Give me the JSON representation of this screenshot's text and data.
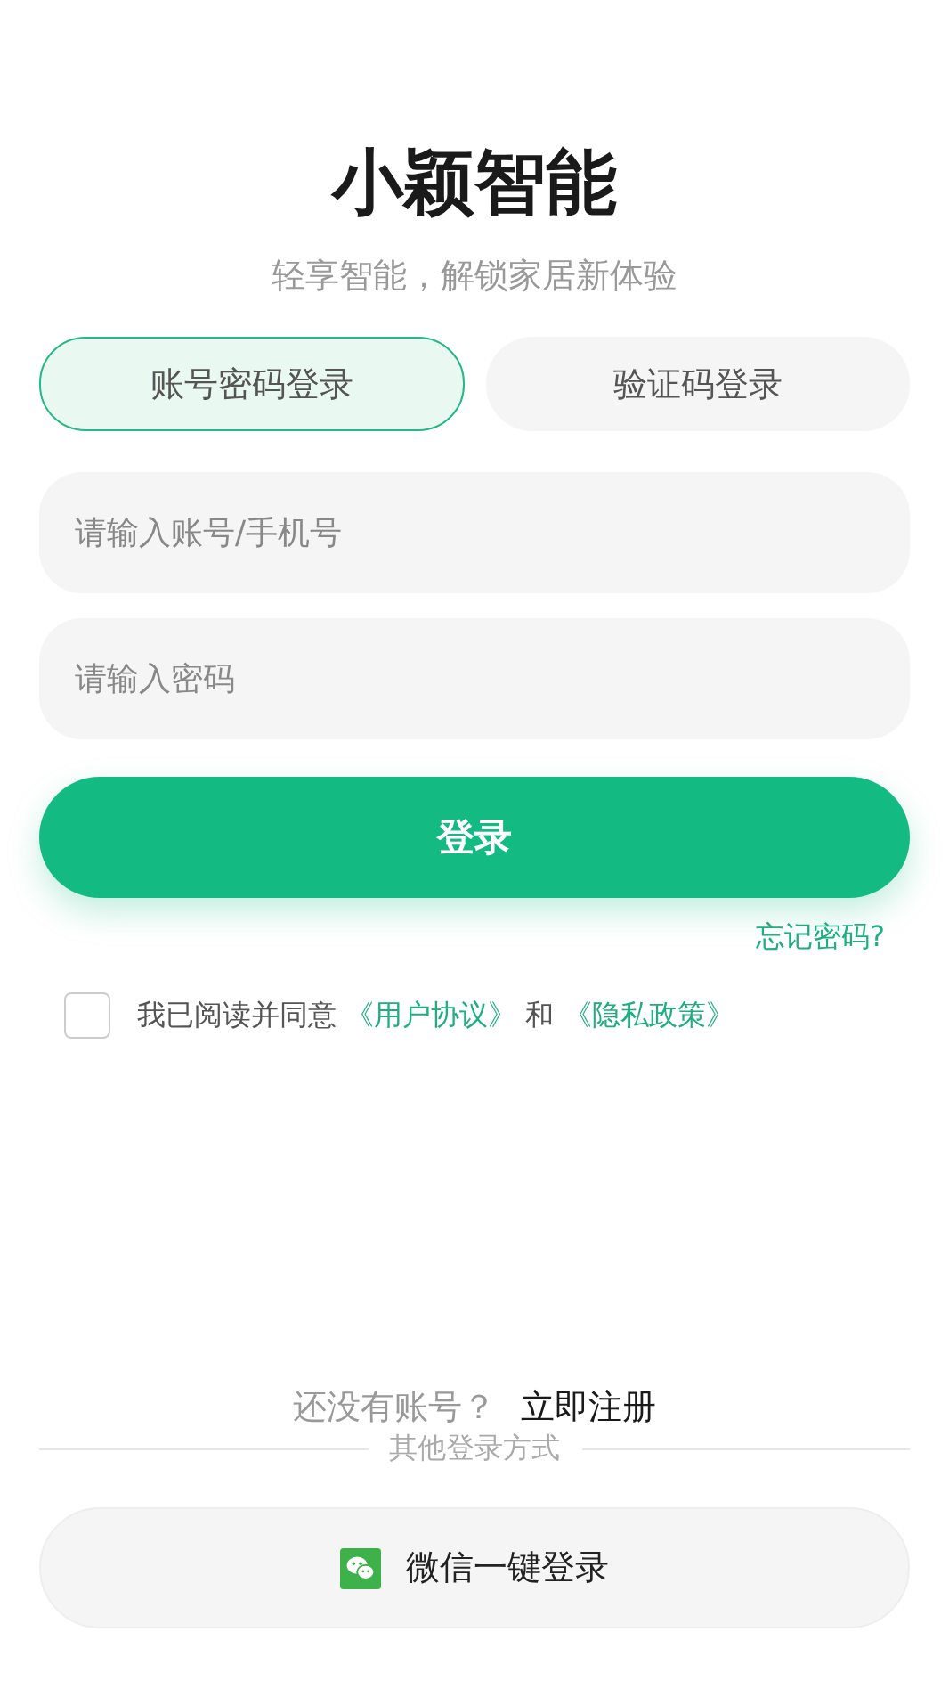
{
  "title": "小颖智能",
  "subtitle": "轻享智能，解锁家居新体验",
  "tabs": [
    {
      "label": "账号密码登录",
      "selected": true
    },
    {
      "label": "验证码登录",
      "selected": false
    }
  ],
  "fields": [
    {
      "placeholder": "请输入账号/手机号"
    },
    {
      "placeholder": "请输入密码"
    }
  ],
  "login_button": "登录",
  "forgot_link": "忘记密码?",
  "agreement": {
    "checked": false,
    "parts": [
      {
        "kind": "text",
        "text": "我已阅读并同意 "
      },
      {
        "kind": "link",
        "text": "《用户协议》"
      },
      {
        "kind": "text",
        "text": " 和 "
      },
      {
        "kind": "link",
        "text": "《隐私政策》"
      }
    ]
  },
  "register": {
    "prompt": "还没有账号？",
    "link": "立即注册"
  },
  "other_login_label": "其他登录方式",
  "wechat_button": "微信一键登录"
}
